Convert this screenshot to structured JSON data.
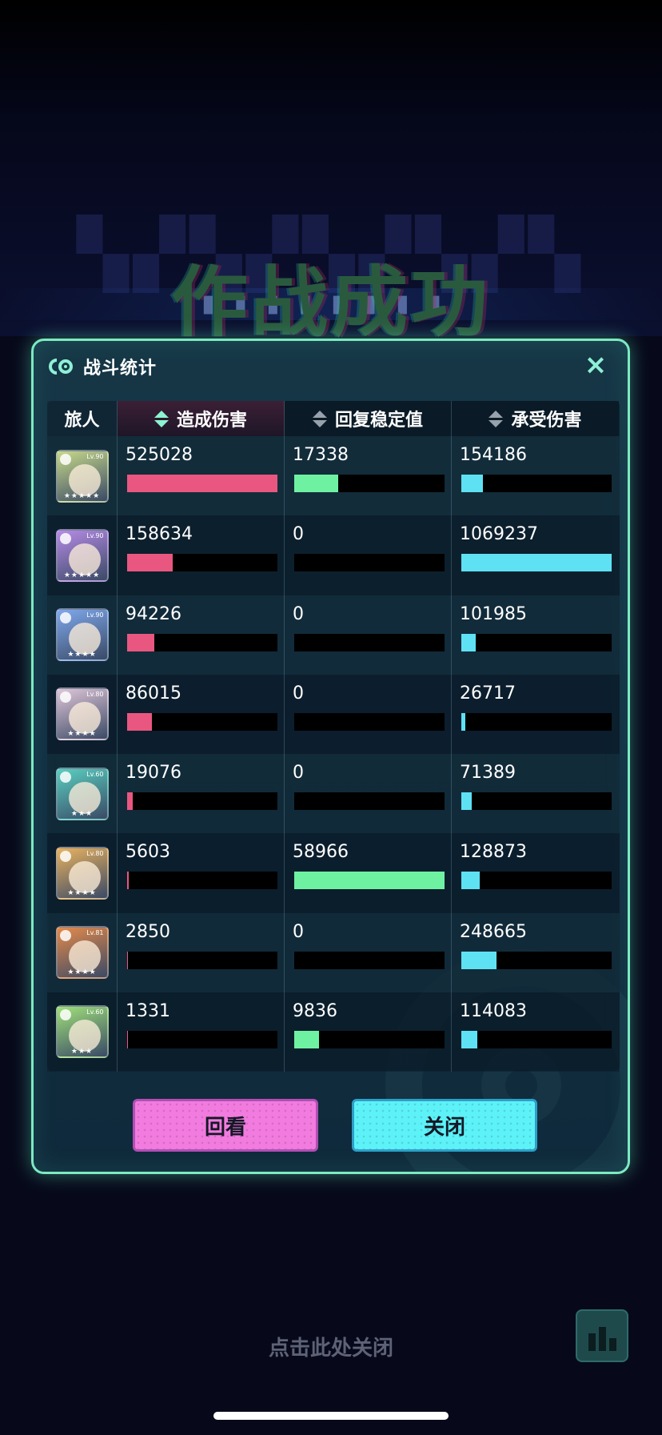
{
  "background": {
    "title": "作战成功",
    "close_hint": "点击此处关闭",
    "stats_icon": "bar-chart-icon"
  },
  "panel": {
    "title": "战斗统计",
    "close_icon": "×",
    "accent_color": "#7de9c2"
  },
  "table": {
    "headers": {
      "name": "旅人",
      "damage": "造成伤害",
      "heal": "回复稳定值",
      "taken": "承受伤害"
    },
    "active_sort": "damage",
    "colors": {
      "damage": "#e95780",
      "heal": "#6ef2a2",
      "taken": "#5fe1f4"
    },
    "rows": [
      {
        "level": "Lv.90",
        "stars": "★★★★★",
        "avatar_color": "#c7d98a",
        "damage": "525028",
        "heal": "17338",
        "taken": "154186",
        "damage_ratio": 1.0,
        "heal_ratio": 0.294,
        "taken_ratio": 0.144
      },
      {
        "level": "Lv.90",
        "stars": "★★★★★",
        "avatar_color": "#b68be6",
        "damage": "158634",
        "heal": "0",
        "taken": "1069237",
        "damage_ratio": 0.302,
        "heal_ratio": 0.0,
        "taken_ratio": 1.0
      },
      {
        "level": "Lv.90",
        "stars": "★★★★",
        "avatar_color": "#7fa8ec",
        "damage": "94226",
        "heal": "0",
        "taken": "101985",
        "damage_ratio": 0.179,
        "heal_ratio": 0.0,
        "taken_ratio": 0.095
      },
      {
        "level": "Lv.80",
        "stars": "★★★★",
        "avatar_color": "#e0c6d8",
        "damage": "86015",
        "heal": "0",
        "taken": "26717",
        "damage_ratio": 0.164,
        "heal_ratio": 0.0,
        "taken_ratio": 0.025
      },
      {
        "level": "Lv.60",
        "stars": "★★★",
        "avatar_color": "#59cfc0",
        "damage": "19076",
        "heal": "0",
        "taken": "71389",
        "damage_ratio": 0.036,
        "heal_ratio": 0.0,
        "taken_ratio": 0.067
      },
      {
        "level": "Lv.80",
        "stars": "★★★★",
        "avatar_color": "#e9b25f",
        "damage": "5603",
        "heal": "58966",
        "taken": "128873",
        "damage_ratio": 0.011,
        "heal_ratio": 1.0,
        "taken_ratio": 0.121
      },
      {
        "level": "Lv.81",
        "stars": "★★★★",
        "avatar_color": "#e48a4a",
        "damage": "2850",
        "heal": "0",
        "taken": "248665",
        "damage_ratio": 0.005,
        "heal_ratio": 0.0,
        "taken_ratio": 0.233
      },
      {
        "level": "Lv.60",
        "stars": "★★★",
        "avatar_color": "#9fe07a",
        "damage": "1331",
        "heal": "9836",
        "taken": "114083",
        "damage_ratio": 0.003,
        "heal_ratio": 0.167,
        "taken_ratio": 0.107
      }
    ]
  },
  "buttons": {
    "replay": "回看",
    "close": "关闭"
  }
}
